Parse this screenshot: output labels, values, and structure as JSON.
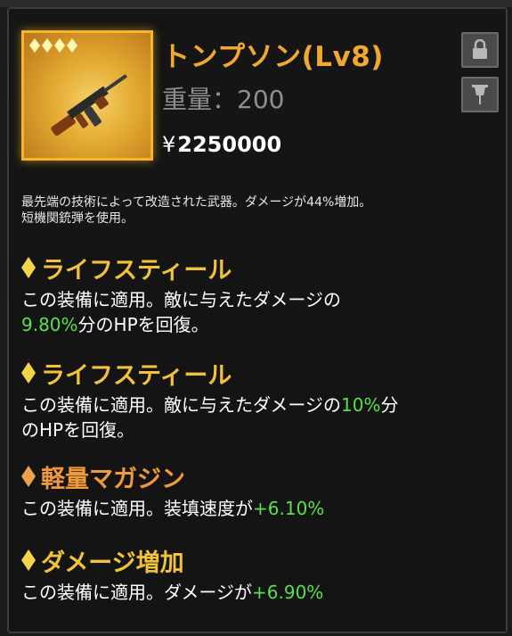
{
  "item": {
    "name": "トンプソン(Lv8)",
    "weight": "重量：200",
    "price_symbol": "¥",
    "price": "2250000",
    "description_line1": "最先端の技術によって改造された武器。ダメージが44%増加。",
    "description_line2": "短機関銃弾を使用。"
  },
  "perks": [
    {
      "title": "ライフスティール",
      "line1_prefix": "この装備に適用。敵に与えたダメージの",
      "value": "9.80%",
      "line2_suffix": "分のHPを回復。"
    },
    {
      "title": "ライフスティール",
      "line1_prefix": "この装備に適用。敵に与えたダメージの",
      "value": "10%",
      "line1_suffix": "分",
      "line2": "のHPを回復。"
    },
    {
      "title": "軽量マガジン",
      "line1_prefix": "この装備に適用。装填速度が",
      "value": "+6.10%"
    },
    {
      "title": "ダメージ増加",
      "line1_prefix": "この装備に適用。ダメージが",
      "value": "+6.90%"
    }
  ],
  "icons": {
    "lock": "lock-icon",
    "pin": "pin-icon",
    "rarity": "diamond-icon"
  },
  "colors": {
    "title": "#f0a830",
    "perk_gold": "#f2c23a",
    "perk_orange": "#f0993c",
    "highlight": "#59e04a"
  }
}
